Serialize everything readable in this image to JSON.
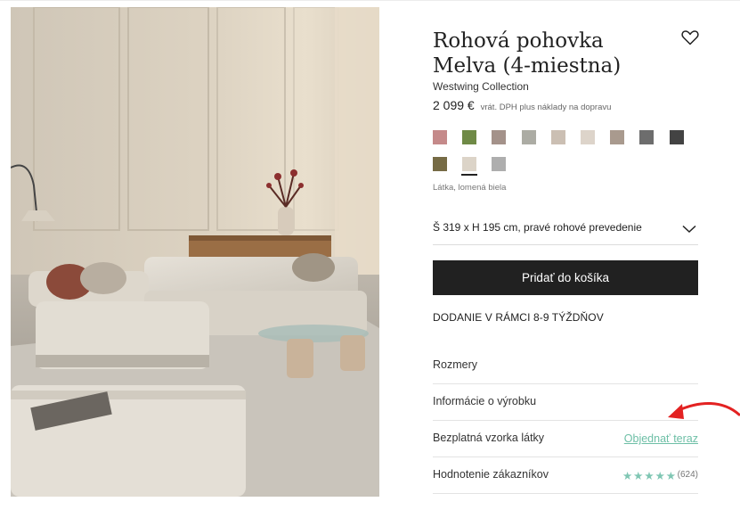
{
  "product": {
    "title": "Rohová pohovka Melva (4-miestna)",
    "brand": "Westwing Collection",
    "price": "2 099 €",
    "price_note": "vrát. DPH plus náklady na dopravu",
    "wishlist_icon": "heart-icon"
  },
  "swatches": {
    "colors": [
      "#c58a8a",
      "#6f8a46",
      "#a4928a",
      "#acaca4",
      "#cbbfb3",
      "#ddd4ca",
      "#a99a8e",
      "#6d6d6d",
      "#434343",
      "#766b45",
      "#dcd4c8",
      "#aeaeae"
    ],
    "selected_index": 10,
    "selected_name": "Látka, lomená biela"
  },
  "size": {
    "value": "Š 319 x H 195 cm, pravé rohové prevedenie",
    "icon": "chevron-down-icon"
  },
  "cart": {
    "label": "Pridať do košíka"
  },
  "delivery": {
    "text": "DODANIE V RÁMCI 8-9 TÝŽDŇOV"
  },
  "info_rows": {
    "dimensions": "Rozmery",
    "product_info": "Informácie o výrobku",
    "sample": {
      "label": "Bezplatná vzorka látky",
      "link": "Objednať teraz"
    },
    "reviews": {
      "label": "Hodnotenie zákazníkov",
      "stars": "★★★★★",
      "rating": 5,
      "count": "(624)"
    }
  },
  "accent_colors": {
    "button": "#212121",
    "link": "#6dbfa6",
    "stars": "#7fc6b3",
    "annotation_arrow": "#e32222"
  }
}
